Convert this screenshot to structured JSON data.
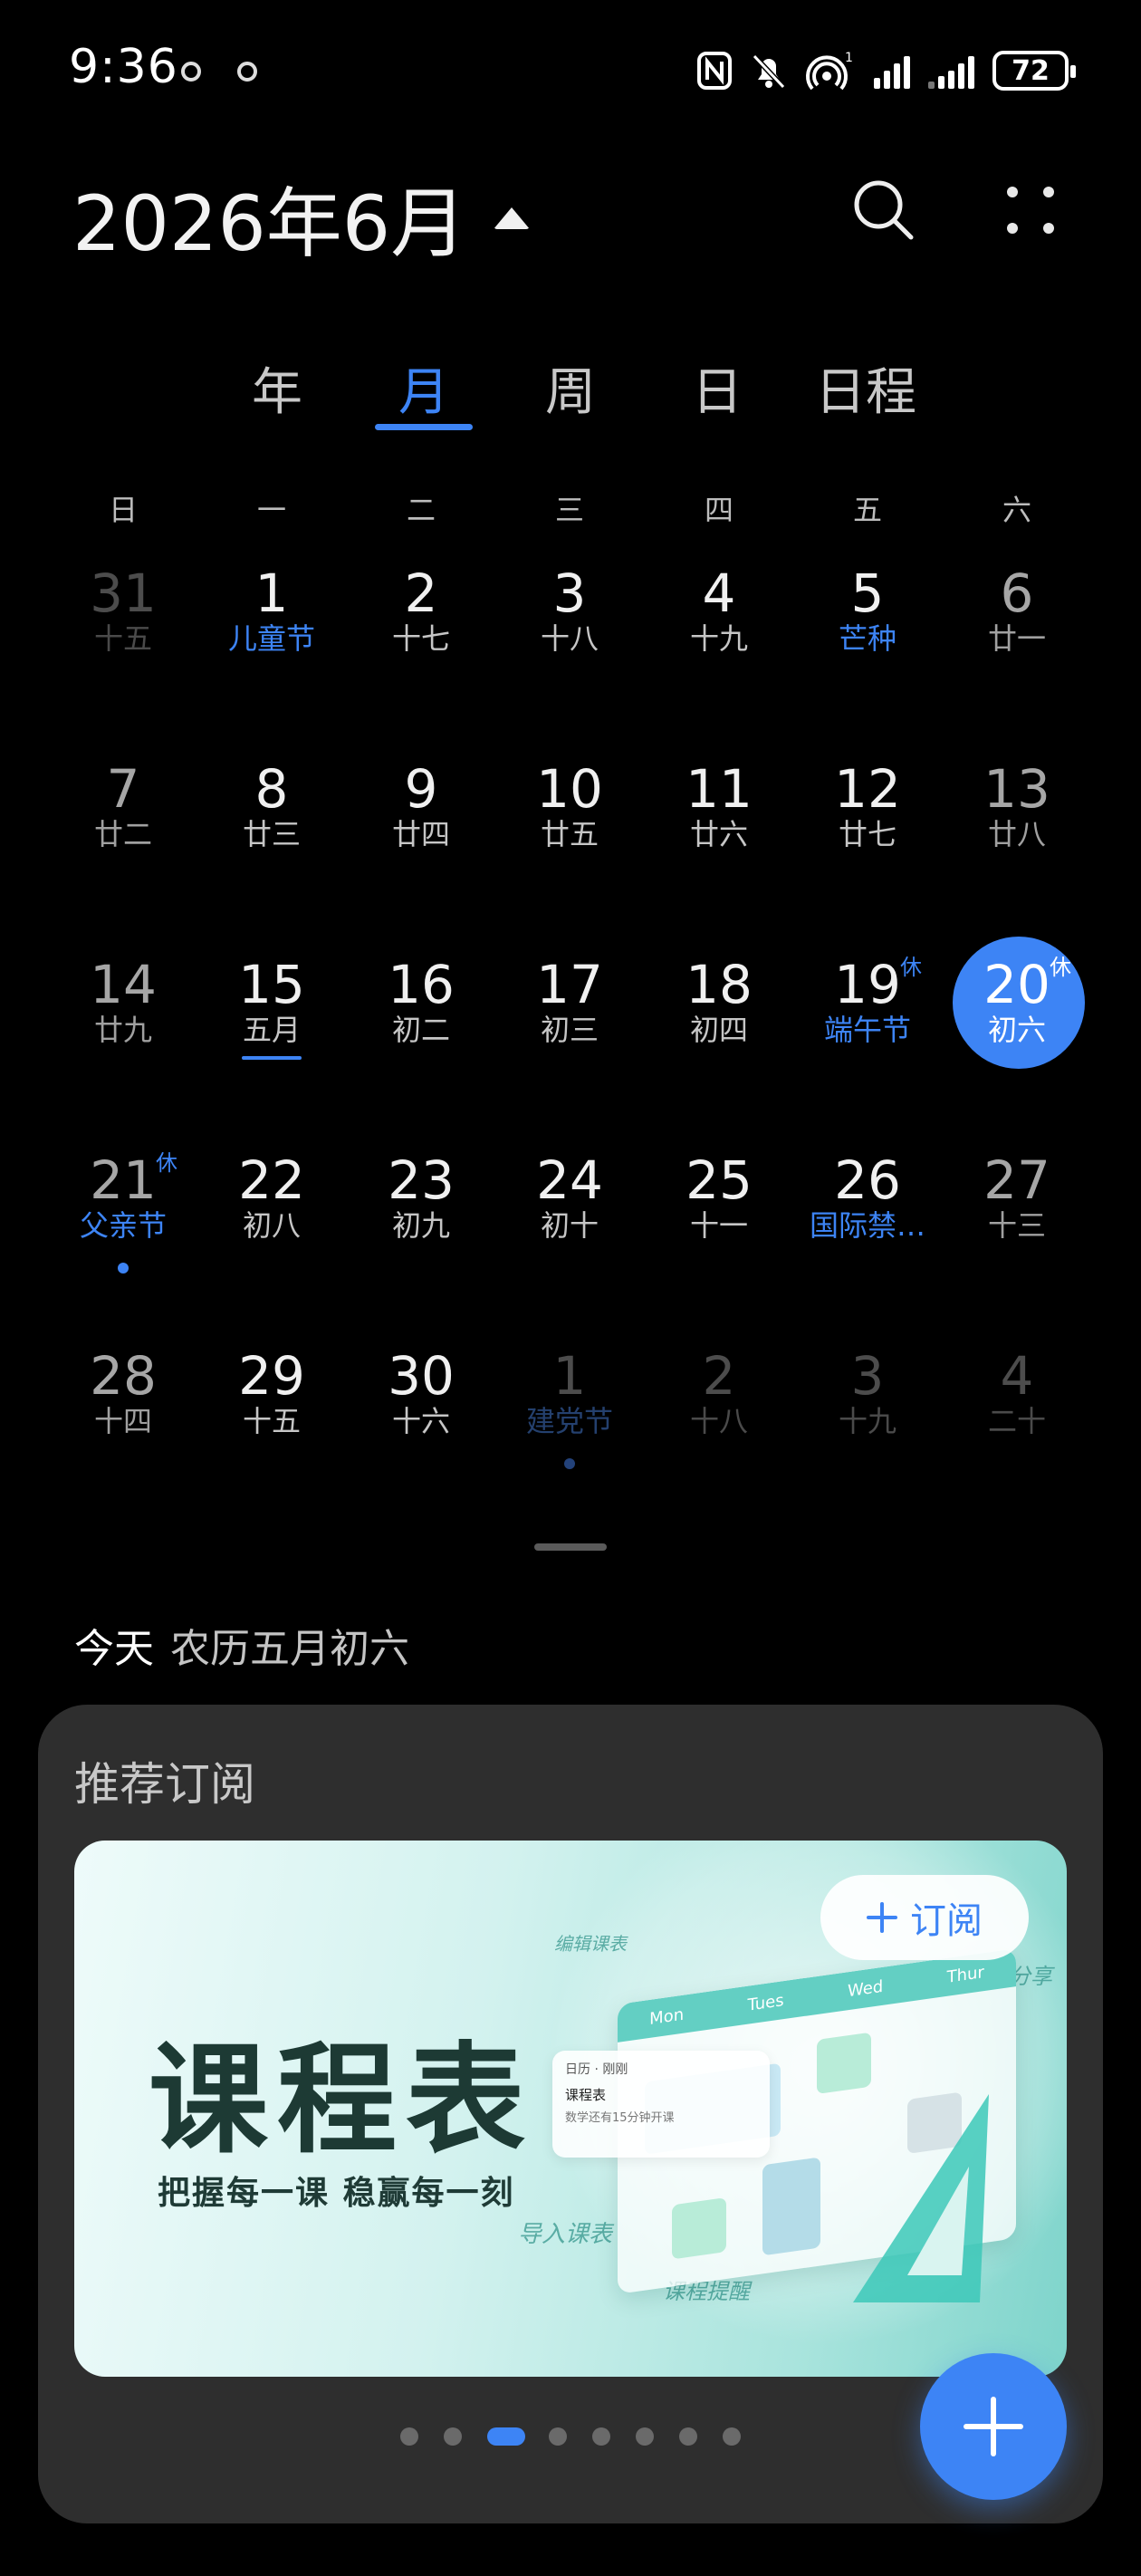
{
  "status_bar": {
    "time": "9:36",
    "battery": "72",
    "icons": [
      "nfc-icon",
      "mute-bell-icon",
      "hotspot-icon",
      "signal-icon",
      "signal-icon",
      "battery-icon"
    ]
  },
  "header": {
    "title": "2026年6月",
    "icons": [
      "caret-up-icon",
      "search-icon",
      "more-icon"
    ]
  },
  "tabs": [
    {
      "label": "年",
      "active": false
    },
    {
      "label": "月",
      "active": true
    },
    {
      "label": "周",
      "active": false
    },
    {
      "label": "日",
      "active": false
    },
    {
      "label": "日程",
      "active": false
    }
  ],
  "weekdays": [
    "日",
    "一",
    "二",
    "三",
    "四",
    "五",
    "六"
  ],
  "weeks": [
    [
      {
        "num": "31",
        "sub": "十五",
        "dim": true
      },
      {
        "num": "1",
        "sub": "儿童节",
        "holiday": true
      },
      {
        "num": "2",
        "sub": "十七"
      },
      {
        "num": "3",
        "sub": "十八"
      },
      {
        "num": "4",
        "sub": "十九"
      },
      {
        "num": "5",
        "sub": "芒种",
        "holiday": true
      },
      {
        "num": "6",
        "sub": "廿一"
      }
    ],
    [
      {
        "num": "7",
        "sub": "廿二"
      },
      {
        "num": "8",
        "sub": "廿三"
      },
      {
        "num": "9",
        "sub": "廿四"
      },
      {
        "num": "10",
        "sub": "廿五"
      },
      {
        "num": "11",
        "sub": "廿六"
      },
      {
        "num": "12",
        "sub": "廿七"
      },
      {
        "num": "13",
        "sub": "廿八"
      }
    ],
    [
      {
        "num": "14",
        "sub": "廿九"
      },
      {
        "num": "15",
        "sub": "五月",
        "underline": true
      },
      {
        "num": "16",
        "sub": "初二"
      },
      {
        "num": "17",
        "sub": "初三"
      },
      {
        "num": "18",
        "sub": "初四"
      },
      {
        "num": "19",
        "sub": "端午节",
        "holiday": true,
        "badge": "休"
      },
      {
        "num": "20",
        "sub": "初六",
        "today": true,
        "badge": "休"
      }
    ],
    [
      {
        "num": "21",
        "sub": "父亲节",
        "holiday": true,
        "badge": "休",
        "dot": true
      },
      {
        "num": "22",
        "sub": "初八"
      },
      {
        "num": "23",
        "sub": "初九"
      },
      {
        "num": "24",
        "sub": "初十"
      },
      {
        "num": "25",
        "sub": "十一"
      },
      {
        "num": "26",
        "sub": "国际禁…",
        "holiday": true
      },
      {
        "num": "27",
        "sub": "十三"
      }
    ],
    [
      {
        "num": "28",
        "sub": "十四"
      },
      {
        "num": "29",
        "sub": "十五"
      },
      {
        "num": "30",
        "sub": "十六"
      },
      {
        "num": "1",
        "sub": "建党节",
        "holiday": true,
        "dim": true,
        "dot": true
      },
      {
        "num": "2",
        "sub": "十八",
        "dim": true
      },
      {
        "num": "3",
        "sub": "十九",
        "dim": true
      },
      {
        "num": "4",
        "sub": "二十",
        "dim": true
      }
    ]
  ],
  "today_row": {
    "label": "今天",
    "lunar": "农历五月初六"
  },
  "recommend": {
    "title": "推荐订阅",
    "banner": {
      "title": "课程表",
      "slogan": "把握每一课  稳赢每一刻",
      "subscribe_label": "订阅",
      "floating": [
        "编辑课表",
        "课表分享",
        "导入课表",
        "课程提醒"
      ],
      "schedule_days": [
        "Mon",
        "Tues",
        "Wed",
        "Thur"
      ],
      "notification": {
        "app": "日历 · 刚刚",
        "title": "课程表",
        "body": "数学还有15分钟开课"
      }
    },
    "pager": {
      "total": 8,
      "active": 2
    }
  },
  "fab": {
    "icon": "plus-icon"
  },
  "colors": {
    "accent": "#3d84f5",
    "background": "#000000",
    "card": "#2e2e2e"
  }
}
